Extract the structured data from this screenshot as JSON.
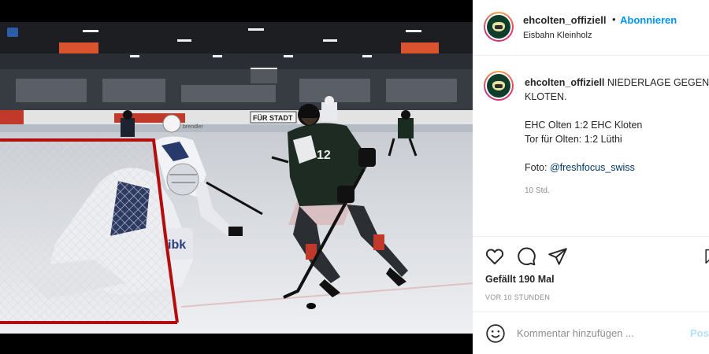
{
  "header": {
    "username": "ehcolten_offiziell",
    "separator": "•",
    "follow_label": "Abonnieren",
    "location": "Eisbahn Kleinholz"
  },
  "caption": {
    "username": "ehcolten_offiziell",
    "line1": "NIEDERLAGE GEGEN",
    "line2": "KLOTEN.",
    "line3": "EHC Olten 1:2 EHC Kloten",
    "line4": "Tor für Olten: 1:2 Lüthi",
    "line5_prefix": "Foto: ",
    "line5_mention": "@freshfocus_swiss",
    "age": "10 Std."
  },
  "actions": {
    "like_icon": "heart-icon",
    "comment_icon": "comment-bubble-icon",
    "share_icon": "paper-plane-icon",
    "save_icon": "bookmark-icon",
    "likes": "Gefällt 190 Mal",
    "timestamp": "VOR 10 STUNDEN"
  },
  "comment": {
    "emoji_icon": "smiley-icon",
    "placeholder": "Kommentar hinzufügen ...",
    "post_label": "Posten"
  },
  "media": {
    "arena_signs": [
      "FÜR STADT",
      "ibk",
      "12",
      "brendler"
    ]
  },
  "colors": {
    "accent": "#0095f6",
    "text": "#262626",
    "muted": "#8e8e8e",
    "post_disabled": "#b2dffc"
  }
}
